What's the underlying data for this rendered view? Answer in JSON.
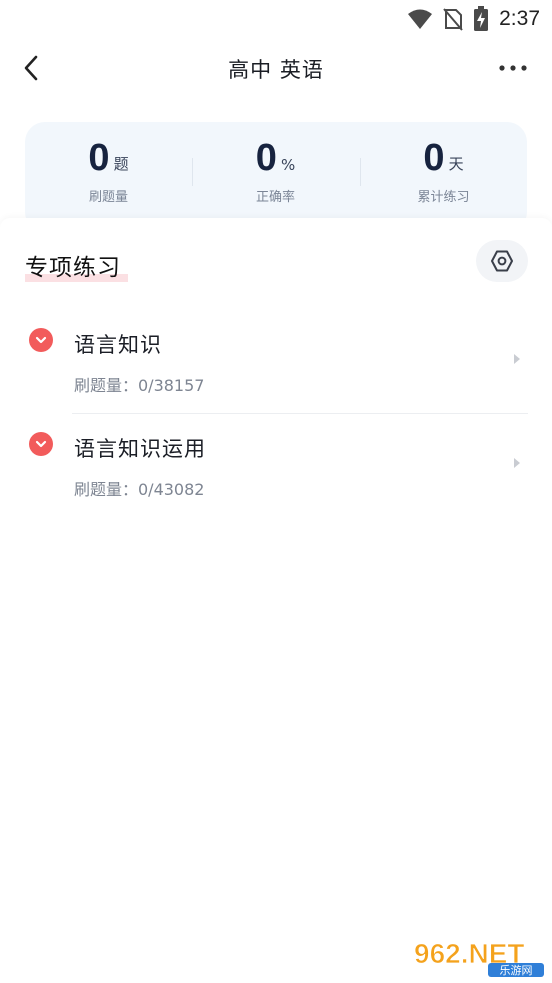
{
  "status_bar": {
    "time": "2:37",
    "icons": [
      "wifi-icon",
      "no-sim-icon",
      "battery-charging-icon"
    ]
  },
  "header": {
    "title": "高中 英语",
    "back_icon": "chevron-left-icon",
    "more_icon": "more-horizontal-icon"
  },
  "stats": [
    {
      "value": "0",
      "unit": "题",
      "label": "刷题量"
    },
    {
      "value": "0",
      "unit": "%",
      "label": "正确率"
    },
    {
      "value": "0",
      "unit": "天",
      "label": "累计练习"
    }
  ],
  "section": {
    "title": "专项练习",
    "settings_icon": "hexagon-settings-icon"
  },
  "practice_items": [
    {
      "name": "语言知识",
      "count": "刷题量：0/38157"
    },
    {
      "name": "语言知识运用",
      "count": "刷题量：0/43082"
    }
  ],
  "colors": {
    "accent_red": "#f25b5b",
    "stats_bg": "#f2f7fc",
    "title_highlight": "#fbe0e3"
  },
  "watermark": {
    "main": "962.NET",
    "sub": "乐游网"
  }
}
